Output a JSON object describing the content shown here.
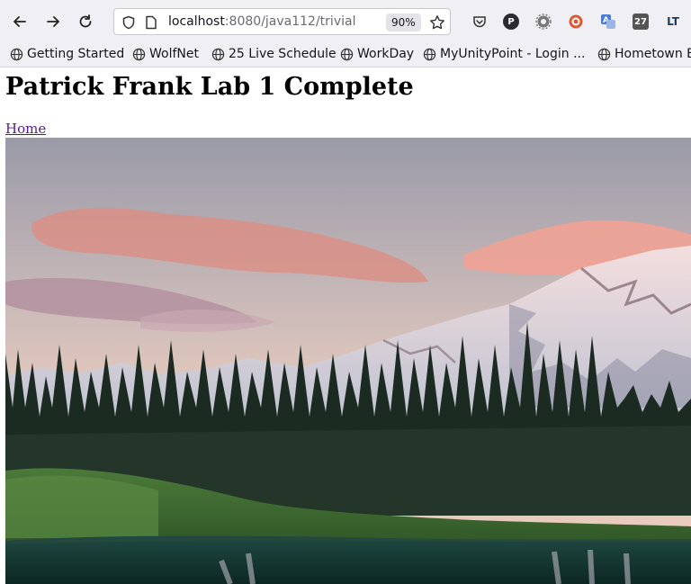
{
  "browser": {
    "url_host": "localhost",
    "url_path": ":8080/java112/trivial",
    "zoom": "90%",
    "extensions": [
      {
        "name": "pocket-icon"
      },
      {
        "name": "p-extension-icon",
        "label": "P"
      },
      {
        "name": "settings-extension-icon"
      },
      {
        "name": "duckduckgo-icon"
      },
      {
        "name": "translate-icon"
      },
      {
        "name": "calendar-27-icon",
        "label": "27"
      },
      {
        "name": "languagetool-icon",
        "label": "LT"
      }
    ]
  },
  "bookmarks": [
    {
      "label": "Getting Started"
    },
    {
      "label": "WolfNet"
    },
    {
      "label": "25 Live Schedule"
    },
    {
      "label": "WorkDay"
    },
    {
      "label": "MyUnityPoint - Login ..."
    },
    {
      "label": "Hometown B"
    }
  ],
  "page": {
    "title": "Patrick Frank Lab 1 Complete",
    "home_link": "Home"
  },
  "colors": {
    "chrome_bg": "#f0f0f4",
    "link_visited": "#551a8b",
    "sky_top": "#9a9aa8",
    "sky_bottom": "#e8cbbd",
    "cloud_pink": "#e39a8c",
    "forest": "#1c2b22",
    "lake": "#0f2d2a"
  }
}
